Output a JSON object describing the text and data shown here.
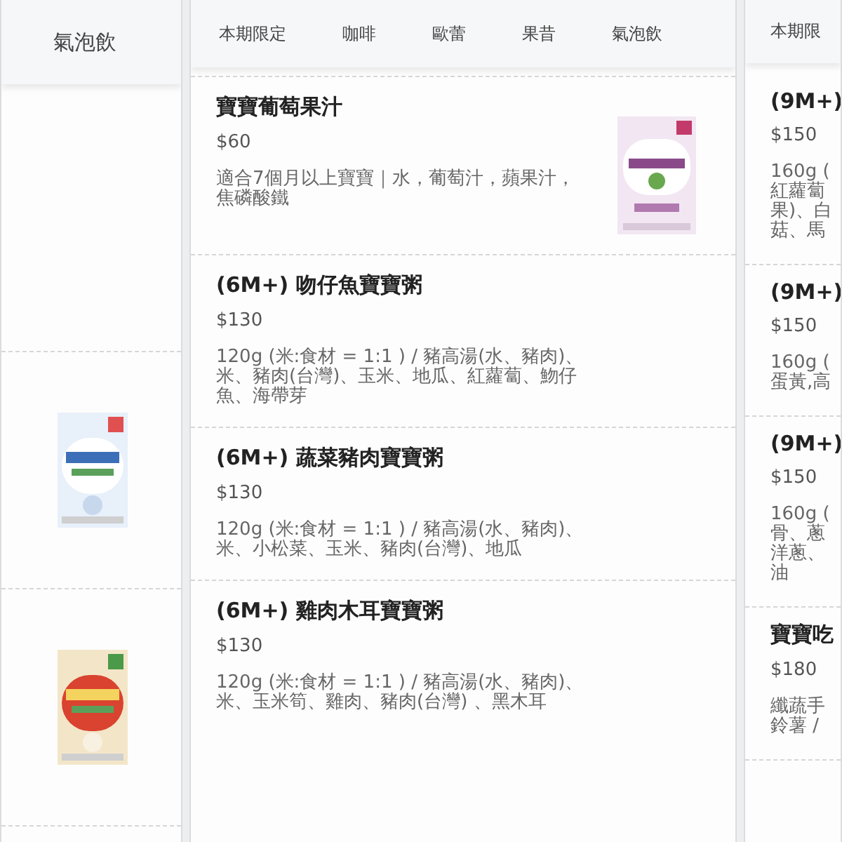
{
  "left_panel": {
    "tabs": [
      {
        "label": "氣泡飲",
        "selected": false
      }
    ],
    "items": [
      {
        "kind": "blank"
      },
      {
        "kind": "picture"
      },
      {
        "kind": "picture"
      }
    ]
  },
  "middle_panel": {
    "tabs": [
      {
        "label": "本期限定",
        "selected": false
      },
      {
        "label": "咖啡",
        "selected": false
      },
      {
        "label": "歐蕾",
        "selected": false
      },
      {
        "label": "果昔",
        "selected": false
      },
      {
        "label": "氣泡飲",
        "selected": false
      }
    ],
    "items": [
      {
        "kind": "picture",
        "title": "寶寶葡萄果汁",
        "price": "$60",
        "description": "適合7個月以上寶寶｜水，葡萄汁，蘋果汁，焦磷酸鐵"
      },
      {
        "kind": "text",
        "title": "(6M+) 吻仔魚寶寶粥",
        "price": "$130",
        "description": "120g (米:食材 = 1:1 ) / 豬高湯(水、豬肉)、米、豬肉(台灣)、玉米、地瓜、紅蘿蔔、魩仔魚、海帶芽"
      },
      {
        "kind": "text",
        "title": "(6M+) 蔬菜豬肉寶寶粥",
        "price": "$130",
        "description": "120g (米:食材 = 1:1 ) / 豬高湯(水、豬肉)、米、小松菜、玉米、豬肉(台灣)、地瓜"
      },
      {
        "kind": "text",
        "title": "(6M+) 雞肉木耳寶寶粥",
        "price": "$130",
        "description": "120g (米:食材 = 1:1 ) / 豬高湯(水、豬肉)、米、玉米筍、雞肉、豬肉(台灣) 、黑木耳"
      }
    ]
  },
  "right_panel": {
    "tabs": [
      {
        "label": "本期限",
        "selected": false
      }
    ],
    "items": [
      {
        "title": "(9M+)",
        "price": "$150",
        "lines": [
          "160g (",
          "紅蘿蔔",
          "果)、白",
          "菇、馬"
        ]
      },
      {
        "title": "(9M+)",
        "price": "$150",
        "lines": [
          "160g (",
          "蛋黃,高"
        ]
      },
      {
        "title": "(9M+)",
        "price": "$150",
        "lines": [
          "160g (",
          "骨、蔥",
          "洋蔥、",
          "油"
        ]
      },
      {
        "title": "寶寶吃",
        "price": "$180",
        "lines": [
          "纖蔬手",
          "鈴薯 /"
        ]
      }
    ]
  }
}
